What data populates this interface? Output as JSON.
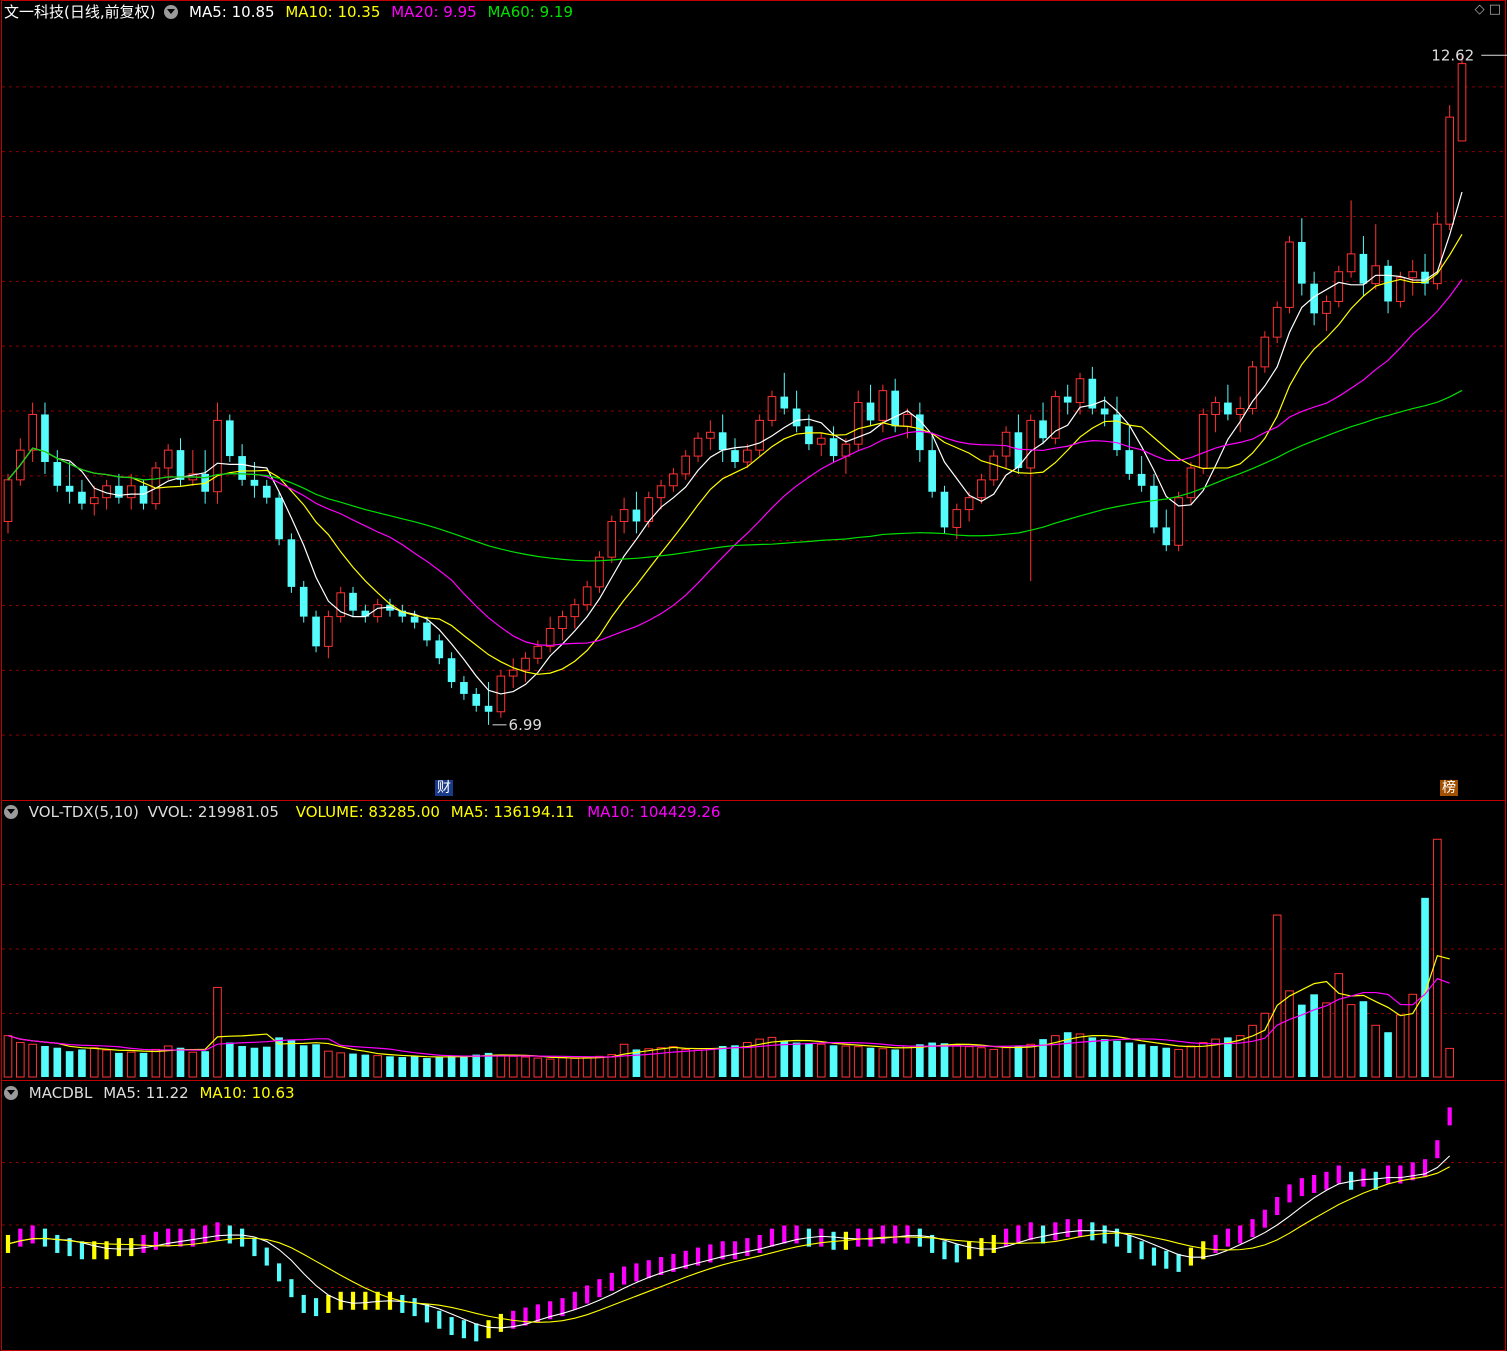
{
  "main": {
    "title": "文一科技(日线,前复权)",
    "ma5": "MA5: 10.85",
    "ma10": "MA10: 10.35",
    "ma20": "MA20: 9.95",
    "ma60": "MA60: 9.19",
    "high_label": "12.62",
    "low_label": "6.99",
    "badge_cai": "财",
    "badge_bang": "榜",
    "corner": "◇ □"
  },
  "volume": {
    "name": "VOL-TDX(5,10)",
    "vvol": "VVOL: 219981.05",
    "volume": "VOLUME: 83285.00",
    "ma5": "MA5: 136194.11",
    "ma10": "MA10: 104429.26"
  },
  "macd": {
    "name": "MACDBL",
    "ma5": "MA5: 11.22",
    "ma10": "MA10: 10.63"
  },
  "colors": {
    "up": "#ff3232",
    "down": "#54fcfc",
    "ma5": "#ffffff",
    "ma10": "#ffff00",
    "ma20": "#ff00ff",
    "ma60": "#00e000",
    "grid": "#8a0000",
    "border": "#c00000"
  },
  "chart_data": [
    {
      "type": "candlestick",
      "title": "文一科技(日线,前复权)",
      "ylim": [
        6.4,
        12.9
      ],
      "annotations": [
        {
          "label": "12.62",
          "value": 12.62,
          "index": 122
        },
        {
          "label": "6.99",
          "value": 6.99,
          "index": 39
        }
      ],
      "ohlc": [
        [
          8.7,
          9.1,
          8.6,
          9.05
        ],
        [
          9.05,
          9.4,
          9.0,
          9.3
        ],
        [
          9.3,
          9.7,
          9.2,
          9.6
        ],
        [
          9.6,
          9.7,
          9.1,
          9.2
        ],
        [
          9.2,
          9.3,
          8.95,
          9.0
        ],
        [
          9.0,
          9.2,
          8.85,
          8.95
        ],
        [
          8.95,
          9.05,
          8.8,
          8.85
        ],
        [
          8.85,
          9.0,
          8.75,
          8.9
        ],
        [
          8.9,
          9.05,
          8.8,
          9.0
        ],
        [
          9.0,
          9.1,
          8.85,
          8.9
        ],
        [
          8.9,
          9.1,
          8.8,
          9.0
        ],
        [
          9.0,
          9.05,
          8.8,
          8.85
        ],
        [
          8.85,
          9.2,
          8.8,
          9.15
        ],
        [
          9.15,
          9.35,
          9.05,
          9.3
        ],
        [
          9.3,
          9.4,
          9.0,
          9.05
        ],
        [
          9.05,
          9.3,
          9.0,
          9.1
        ],
        [
          9.1,
          9.3,
          8.85,
          8.95
        ],
        [
          8.95,
          9.7,
          8.85,
          9.55
        ],
        [
          9.55,
          9.6,
          9.2,
          9.25
        ],
        [
          9.25,
          9.35,
          9.0,
          9.05
        ],
        [
          9.05,
          9.2,
          8.9,
          9.0
        ],
        [
          9.0,
          9.05,
          8.85,
          8.9
        ],
        [
          8.9,
          8.95,
          8.5,
          8.55
        ],
        [
          8.55,
          8.6,
          8.1,
          8.15
        ],
        [
          8.15,
          8.2,
          7.85,
          7.9
        ],
        [
          7.9,
          7.95,
          7.6,
          7.65
        ],
        [
          7.65,
          7.95,
          7.55,
          7.9
        ],
        [
          7.9,
          8.15,
          7.85,
          8.1
        ],
        [
          8.1,
          8.15,
          7.9,
          7.95
        ],
        [
          7.95,
          8.0,
          7.85,
          7.9
        ],
        [
          7.9,
          8.05,
          7.85,
          8.0
        ],
        [
          8.0,
          8.05,
          7.9,
          7.95
        ],
        [
          7.95,
          8.0,
          7.85,
          7.9
        ],
        [
          7.9,
          7.95,
          7.8,
          7.85
        ],
        [
          7.85,
          7.9,
          7.65,
          7.7
        ],
        [
          7.7,
          7.75,
          7.5,
          7.55
        ],
        [
          7.55,
          7.6,
          7.3,
          7.35
        ],
        [
          7.35,
          7.4,
          7.2,
          7.25
        ],
        [
          7.25,
          7.3,
          7.1,
          7.15
        ],
        [
          7.15,
          7.35,
          6.99,
          7.1
        ],
        [
          7.1,
          7.45,
          7.05,
          7.4
        ],
        [
          7.4,
          7.55,
          7.3,
          7.45
        ],
        [
          7.45,
          7.6,
          7.35,
          7.55
        ],
        [
          7.55,
          7.7,
          7.5,
          7.65
        ],
        [
          7.65,
          7.9,
          7.6,
          7.8
        ],
        [
          7.8,
          7.95,
          7.7,
          7.9
        ],
        [
          7.9,
          8.05,
          7.8,
          8.0
        ],
        [
          8.0,
          8.2,
          7.95,
          8.15
        ],
        [
          8.15,
          8.45,
          8.1,
          8.4
        ],
        [
          8.4,
          8.75,
          8.35,
          8.7
        ],
        [
          8.7,
          8.9,
          8.6,
          8.8
        ],
        [
          8.8,
          8.95,
          8.6,
          8.7
        ],
        [
          8.7,
          8.95,
          8.65,
          8.9
        ],
        [
          8.9,
          9.05,
          8.8,
          9.0
        ],
        [
          9.0,
          9.15,
          8.95,
          9.1
        ],
        [
          9.1,
          9.3,
          9.05,
          9.25
        ],
        [
          9.25,
          9.45,
          9.2,
          9.4
        ],
        [
          9.4,
          9.55,
          9.3,
          9.45
        ],
        [
          9.45,
          9.6,
          9.2,
          9.3
        ],
        [
          9.3,
          9.4,
          9.15,
          9.2
        ],
        [
          9.2,
          9.35,
          9.15,
          9.3
        ],
        [
          9.3,
          9.6,
          9.25,
          9.55
        ],
        [
          9.55,
          9.8,
          9.5,
          9.75
        ],
        [
          9.75,
          9.95,
          9.6,
          9.65
        ],
        [
          9.65,
          9.8,
          9.45,
          9.5
        ],
        [
          9.5,
          9.6,
          9.3,
          9.35
        ],
        [
          9.35,
          9.45,
          9.25,
          9.4
        ],
        [
          9.4,
          9.5,
          9.2,
          9.25
        ],
        [
          9.25,
          9.4,
          9.1,
          9.35
        ],
        [
          9.35,
          9.8,
          9.3,
          9.7
        ],
        [
          9.7,
          9.85,
          9.5,
          9.55
        ],
        [
          9.55,
          9.85,
          9.45,
          9.8
        ],
        [
          9.8,
          9.9,
          9.45,
          9.5
        ],
        [
          9.5,
          9.65,
          9.4,
          9.6
        ],
        [
          9.6,
          9.7,
          9.2,
          9.3
        ],
        [
          9.3,
          9.45,
          8.9,
          8.95
        ],
        [
          8.95,
          9.0,
          8.6,
          8.65
        ],
        [
          8.65,
          8.85,
          8.55,
          8.8
        ],
        [
          8.8,
          8.95,
          8.7,
          8.9
        ],
        [
          8.9,
          9.1,
          8.85,
          9.05
        ],
        [
          9.05,
          9.3,
          9.0,
          9.25
        ],
        [
          9.25,
          9.5,
          9.15,
          9.45
        ],
        [
          9.45,
          9.6,
          9.1,
          9.15
        ],
        [
          9.15,
          9.6,
          8.2,
          9.55
        ],
        [
          9.55,
          9.7,
          9.35,
          9.4
        ],
        [
          9.4,
          9.8,
          9.35,
          9.75
        ],
        [
          9.75,
          9.85,
          9.6,
          9.7
        ],
        [
          9.7,
          9.95,
          9.6,
          9.9
        ],
        [
          9.9,
          10.0,
          9.6,
          9.65
        ],
        [
          9.65,
          9.75,
          9.5,
          9.6
        ],
        [
          9.6,
          9.75,
          9.25,
          9.3
        ],
        [
          9.3,
          9.5,
          9.05,
          9.1
        ],
        [
          9.1,
          9.25,
          8.95,
          9.0
        ],
        [
          9.0,
          9.1,
          8.6,
          8.65
        ],
        [
          8.65,
          8.8,
          8.45,
          8.5
        ],
        [
          8.5,
          8.95,
          8.45,
          8.9
        ],
        [
          8.9,
          9.2,
          8.85,
          9.15
        ],
        [
          9.15,
          9.65,
          9.1,
          9.6
        ],
        [
          9.6,
          9.75,
          9.45,
          9.7
        ],
        [
          9.7,
          9.85,
          9.55,
          9.6
        ],
        [
          9.6,
          9.75,
          9.45,
          9.65
        ],
        [
          9.65,
          10.05,
          9.6,
          10.0
        ],
        [
          10.0,
          10.3,
          9.95,
          10.25
        ],
        [
          10.25,
          10.55,
          10.2,
          10.5
        ],
        [
          10.5,
          11.1,
          10.45,
          11.05
        ],
        [
          11.05,
          11.25,
          10.6,
          10.7
        ],
        [
          10.7,
          10.8,
          10.35,
          10.45
        ],
        [
          10.45,
          10.6,
          10.3,
          10.55
        ],
        [
          10.55,
          10.85,
          10.5,
          10.8
        ],
        [
          10.8,
          11.4,
          10.75,
          10.95
        ],
        [
          10.95,
          11.1,
          10.6,
          10.7
        ],
        [
          10.7,
          11.2,
          10.65,
          10.85
        ],
        [
          10.85,
          10.9,
          10.45,
          10.55
        ],
        [
          10.55,
          10.8,
          10.5,
          10.75
        ],
        [
          10.75,
          10.9,
          10.6,
          10.8
        ],
        [
          10.8,
          10.95,
          10.6,
          10.7
        ],
        [
          10.7,
          11.3,
          10.65,
          11.2
        ],
        [
          11.2,
          12.2,
          11.15,
          12.1
        ],
        [
          11.9,
          12.62,
          11.9,
          12.55
        ]
      ],
      "ma_values": {
        "MA5": 10.85,
        "MA10": 10.35,
        "MA20": 9.95,
        "MA60": 9.19
      }
    },
    {
      "type": "bar",
      "title": "VOL-TDX(5,10)",
      "series_name": "VOLUME",
      "volume": [
        120,
        100,
        95,
        90,
        85,
        75,
        80,
        85,
        78,
        70,
        72,
        70,
        80,
        90,
        85,
        72,
        75,
        260,
        100,
        90,
        85,
        88,
        115,
        108,
        92,
        95,
        75,
        70,
        68,
        65,
        62,
        60,
        58,
        60,
        55,
        58,
        62,
        60,
        65,
        70,
        62,
        60,
        58,
        55,
        52,
        56,
        54,
        58,
        60,
        65,
        95,
        80,
        82,
        85,
        88,
        80,
        78,
        82,
        90,
        92,
        100,
        110,
        115,
        105,
        100,
        98,
        95,
        92,
        90,
        88,
        85,
        82,
        80,
        90,
        95,
        100,
        98,
        92,
        88,
        85,
        80,
        85,
        90,
        95,
        110,
        120,
        130,
        125,
        115,
        110,
        105,
        100,
        95,
        90,
        85,
        80,
        90,
        100,
        110,
        115,
        120,
        150,
        185,
        470,
        250,
        210,
        240,
        215,
        300,
        210,
        220,
        150,
        130,
        180,
        240,
        520,
        690,
        83
      ],
      "labels": {
        "VVOL": 219981.05,
        "VOLUME": 83285.0,
        "MA5": 136194.11,
        "MA10": 104429.26
      }
    },
    {
      "type": "bar",
      "title": "MACDBL",
      "values": [
        9.2,
        9.3,
        9.35,
        9.3,
        9.2,
        9.15,
        9.1,
        9.1,
        9.1,
        9.15,
        9.15,
        9.2,
        9.25,
        9.3,
        9.3,
        9.3,
        9.35,
        9.4,
        9.35,
        9.3,
        9.15,
        9.0,
        8.75,
        8.5,
        8.25,
        8.2,
        8.25,
        8.3,
        8.3,
        8.3,
        8.3,
        8.3,
        8.25,
        8.2,
        8.1,
        8.0,
        7.9,
        7.85,
        7.8,
        7.85,
        7.95,
        8.0,
        8.05,
        8.1,
        8.15,
        8.2,
        8.3,
        8.4,
        8.5,
        8.6,
        8.7,
        8.75,
        8.8,
        8.85,
        8.9,
        8.95,
        9.0,
        9.05,
        9.1,
        9.1,
        9.15,
        9.2,
        9.3,
        9.35,
        9.35,
        9.3,
        9.3,
        9.25,
        9.25,
        9.3,
        9.3,
        9.35,
        9.35,
        9.35,
        9.3,
        9.2,
        9.1,
        9.05,
        9.1,
        9.15,
        9.2,
        9.3,
        9.35,
        9.4,
        9.35,
        9.4,
        9.45,
        9.45,
        9.4,
        9.35,
        9.3,
        9.2,
        9.1,
        9.0,
        8.95,
        8.9,
        9.0,
        9.1,
        9.2,
        9.3,
        9.35,
        9.45,
        9.6,
        9.8,
        10.0,
        10.1,
        10.15,
        10.2,
        10.3,
        10.2,
        10.25,
        10.2,
        10.3,
        10.3,
        10.35,
        10.4,
        10.7,
        11.22
      ],
      "labels": {
        "MA5": 11.22,
        "MA10": 10.63
      }
    }
  ]
}
